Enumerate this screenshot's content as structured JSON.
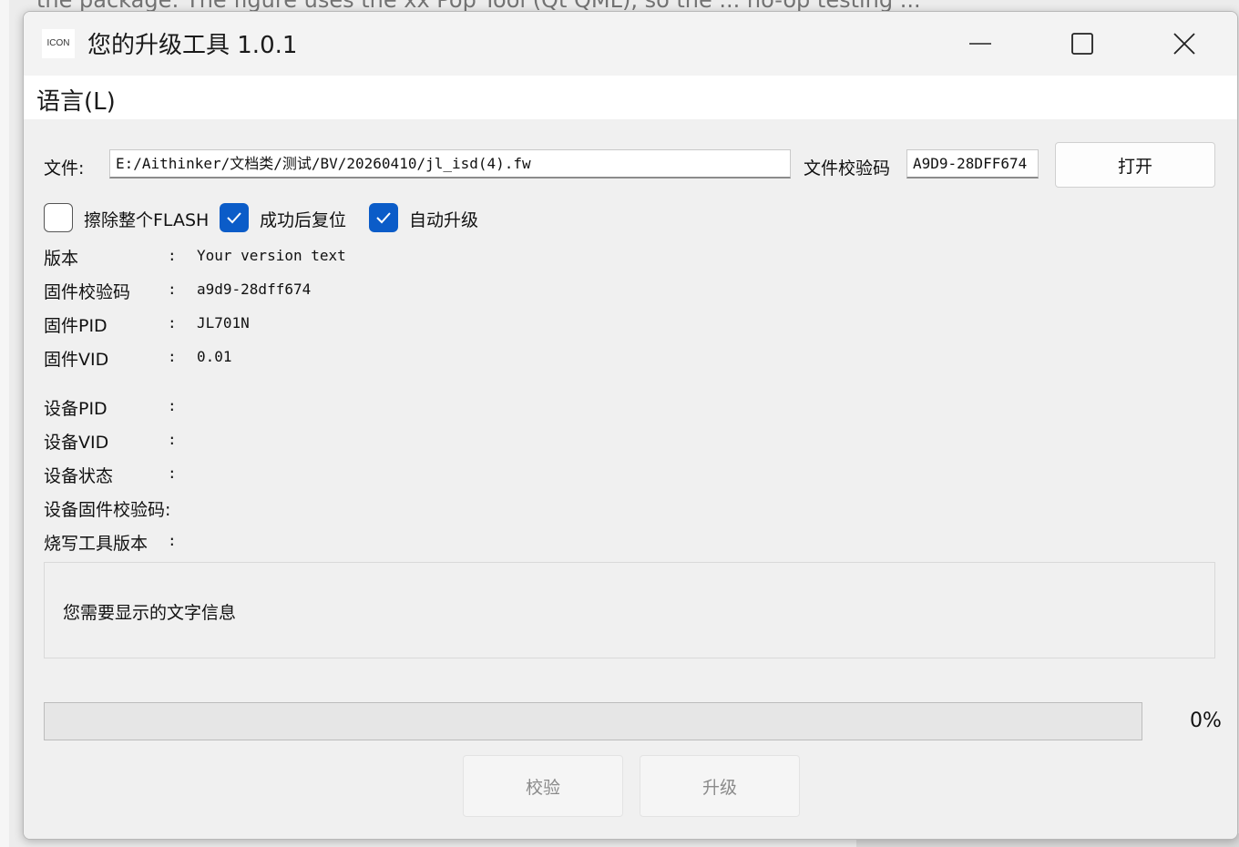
{
  "background": {
    "top_text": "the package: The figure uses the xx Pop Tool (Qt QML), so the ... no-op testing ..."
  },
  "window": {
    "icon_text": "ICON",
    "title": "您的升级工具 1.0.1",
    "controls": {
      "minimize": "minimize",
      "maximize": "maximize",
      "close": "close"
    }
  },
  "menu": {
    "language": "语言(L)"
  },
  "file_row": {
    "label": "文件:",
    "path": "E:/Aithinker/文档类/测试/BV/20260410/jl_isd(4).fw",
    "checksum_label": "文件校验码",
    "checksum_value": "A9D9-28DFF674",
    "open_button": "打开"
  },
  "options": [
    {
      "label": "擦除整个FLASH",
      "checked": false
    },
    {
      "label": "成功后复位",
      "checked": true
    },
    {
      "label": "自动升级",
      "checked": true
    }
  ],
  "firmware_info": [
    {
      "label": "版本",
      "sep": ":",
      "value": "Your version text"
    },
    {
      "label": "固件校验码",
      "sep": ":",
      "value": "a9d9-28dff674"
    },
    {
      "label": "固件PID",
      "sep": ":",
      "value": "JL701N"
    },
    {
      "label": "固件VID",
      "sep": ":",
      "value": "0.01"
    }
  ],
  "device_info": [
    {
      "label": "设备PID",
      "sep": ":",
      "value": ""
    },
    {
      "label": "设备VID",
      "sep": ":",
      "value": ""
    },
    {
      "label": "设备状态",
      "sep": ":",
      "value": ""
    },
    {
      "label": "设备固件校验码:",
      "sep": "",
      "value": ""
    },
    {
      "label": "烧写工具版本",
      "sep": ":",
      "value": ""
    }
  ],
  "message": "您需要显示的文字信息",
  "progress": {
    "value": 0,
    "text": "0%"
  },
  "actions": {
    "verify": "校验",
    "upgrade": "升级"
  },
  "colors": {
    "accent": "#0b5cc8",
    "titlebar": "#f3f3f3",
    "window_bg": "#f0f0f0"
  }
}
